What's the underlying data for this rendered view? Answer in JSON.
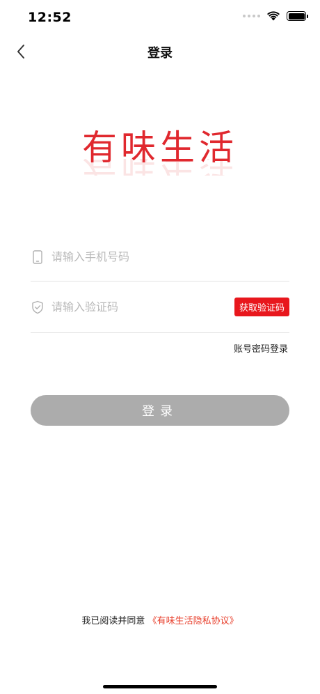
{
  "status_bar": {
    "time": "12:52"
  },
  "nav": {
    "title": "登录"
  },
  "logo": {
    "text": "有味生活"
  },
  "form": {
    "phone_placeholder": "请输入手机号码",
    "code_placeholder": "请输入验证码",
    "get_code_label": "获取验证码"
  },
  "links": {
    "password_login": "账号密码登录"
  },
  "login_button": {
    "label": "登录"
  },
  "agreement": {
    "prefix": "我已阅读并同意",
    "link": "《有味生活隐私协议》"
  },
  "colors": {
    "brand_red": "#e8171d",
    "button_gray": "#acacac",
    "link_red": "#e8422f"
  }
}
